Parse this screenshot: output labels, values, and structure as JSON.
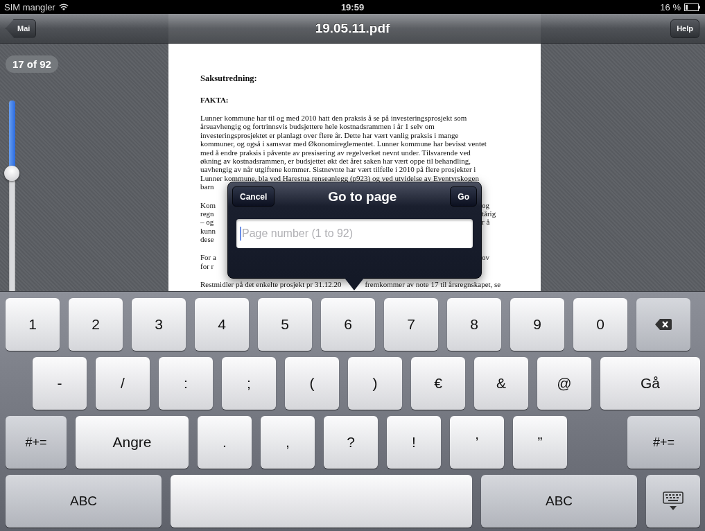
{
  "status_bar": {
    "carrier": "SIM mangler",
    "time": "19:59",
    "battery": "16 %"
  },
  "nav_bar": {
    "back_button": "Mai",
    "title": "19.05.11.pdf",
    "help_button": "Help"
  },
  "page_indicator": "17 of 92",
  "page_slider": {
    "level": 0.38
  },
  "document": {
    "heading": "Saksutredning:",
    "subheading": "FAKTA:",
    "paragraphs": [
      {
        "lines": [
          {
            "kind": "full",
            "text": "Lunner kommune har til og med 2010 hatt den praksis å se på investeringsprosjekt som"
          },
          {
            "kind": "full",
            "text": "årsuavhengig og fortrinnsvis budsjettere hele kostnadsrammen i år 1 selv om"
          },
          {
            "kind": "full",
            "text": "investeringsprosjektet er planlagt over flere år. Dette har vært vanlig praksis i mange"
          },
          {
            "kind": "full",
            "text": "kommuner, og også i samsvar med Økonomireglementet. Lunner kommune har bevisst ventet"
          },
          {
            "kind": "full",
            "text": "med å endre praksis i påvente av presisering av regelverket nevnt under. Tilsvarende ved"
          },
          {
            "kind": "full",
            "text": "økning av kostnadsrammen, er budsjettet økt det året saken har vært oppe til behandling,"
          },
          {
            "kind": "full",
            "text": "uavhengig av når utgiftene kommer. Sistnevnte har vært tilfelle i 2010 på flere prosjekter i"
          },
          {
            "kind": "full",
            "text": "Lunner kommune, bla ved Harestua renseanlegg (p923) og ved utvidelse av Eventyrskogen"
          },
          {
            "kind": "split",
            "left": "barn"
          }
        ]
      },
      {
        "lines": [
          {
            "kind": "split",
            "left": "Kom",
            "right": "og"
          },
          {
            "kind": "split",
            "left": "regn",
            "right": "tårig"
          },
          {
            "kind": "split",
            "left": "– og",
            "right": "r å"
          },
          {
            "kind": "split",
            "left": "kunn"
          },
          {
            "kind": "split",
            "left": "dese"
          }
        ]
      },
      {
        "lines": [
          {
            "kind": "split",
            "left": "For a",
            "right": "ov"
          },
          {
            "kind": "split",
            "left": "for r"
          }
        ]
      },
      {
        "lines": [
          {
            "kind": "split",
            "left": "Restmidler på det enkelte prosjekt pr 31.12.20",
            "right": "fremkommer av note 17 til årsregnskapet, se"
          }
        ]
      }
    ]
  },
  "dialog": {
    "cancel_button": "Cancel",
    "title": "Go to page",
    "go_button": "Go",
    "input": {
      "placeholder": "Page number (1 to 92)"
    }
  },
  "keyboard": {
    "rows": [
      [
        {
          "kind": "char",
          "label": "1"
        },
        {
          "kind": "char",
          "label": "2"
        },
        {
          "kind": "char",
          "label": "3"
        },
        {
          "kind": "char",
          "label": "4"
        },
        {
          "kind": "char",
          "label": "5"
        },
        {
          "kind": "char",
          "label": "6"
        },
        {
          "kind": "char",
          "label": "7"
        },
        {
          "kind": "char",
          "label": "8"
        },
        {
          "kind": "char",
          "label": "9"
        },
        {
          "kind": "char",
          "label": "0"
        },
        {
          "kind": "backspace"
        }
      ],
      [
        {
          "kind": "char",
          "label": "-"
        },
        {
          "kind": "char",
          "label": "/"
        },
        {
          "kind": "char",
          "label": ":"
        },
        {
          "kind": "char",
          "label": ";"
        },
        {
          "kind": "char",
          "label": "("
        },
        {
          "kind": "char",
          "label": ")"
        },
        {
          "kind": "char",
          "label": "€"
        },
        {
          "kind": "char",
          "label": "&"
        },
        {
          "kind": "char",
          "label": "@"
        },
        {
          "kind": "return",
          "label": "Gå"
        }
      ],
      [
        {
          "kind": "symbols",
          "label": "#+="
        },
        {
          "kind": "undo",
          "label": "Angre"
        },
        {
          "kind": "char",
          "label": "."
        },
        {
          "kind": "char",
          "label": ","
        },
        {
          "kind": "char",
          "label": "?"
        },
        {
          "kind": "char",
          "label": "!"
        },
        {
          "kind": "char",
          "label": "’"
        },
        {
          "kind": "char",
          "label": "”"
        },
        {
          "kind": "symbols",
          "label": "#+="
        }
      ],
      [
        {
          "kind": "mode",
          "label": "ABC"
        },
        {
          "kind": "space"
        },
        {
          "kind": "mode",
          "label": "ABC"
        },
        {
          "kind": "hide"
        }
      ]
    ]
  }
}
